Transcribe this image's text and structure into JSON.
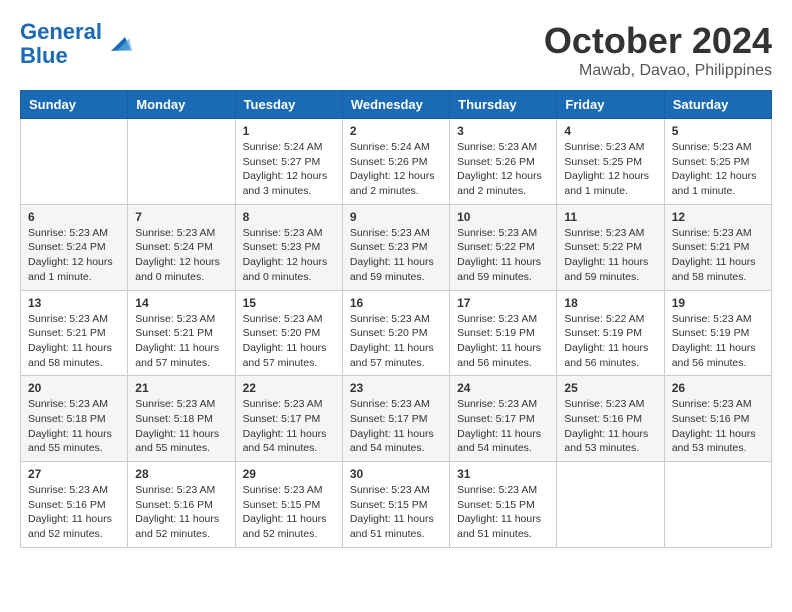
{
  "logo": {
    "line1": "General",
    "line2": "Blue"
  },
  "title": "October 2024",
  "location": "Mawab, Davao, Philippines",
  "headers": [
    "Sunday",
    "Monday",
    "Tuesday",
    "Wednesday",
    "Thursday",
    "Friday",
    "Saturday"
  ],
  "weeks": [
    [
      {
        "day": "",
        "info": ""
      },
      {
        "day": "",
        "info": ""
      },
      {
        "day": "1",
        "info": "Sunrise: 5:24 AM\nSunset: 5:27 PM\nDaylight: 12 hours and 3 minutes."
      },
      {
        "day": "2",
        "info": "Sunrise: 5:24 AM\nSunset: 5:26 PM\nDaylight: 12 hours and 2 minutes."
      },
      {
        "day": "3",
        "info": "Sunrise: 5:23 AM\nSunset: 5:26 PM\nDaylight: 12 hours and 2 minutes."
      },
      {
        "day": "4",
        "info": "Sunrise: 5:23 AM\nSunset: 5:25 PM\nDaylight: 12 hours and 1 minute."
      },
      {
        "day": "5",
        "info": "Sunrise: 5:23 AM\nSunset: 5:25 PM\nDaylight: 12 hours and 1 minute."
      }
    ],
    [
      {
        "day": "6",
        "info": "Sunrise: 5:23 AM\nSunset: 5:24 PM\nDaylight: 12 hours and 1 minute."
      },
      {
        "day": "7",
        "info": "Sunrise: 5:23 AM\nSunset: 5:24 PM\nDaylight: 12 hours and 0 minutes."
      },
      {
        "day": "8",
        "info": "Sunrise: 5:23 AM\nSunset: 5:23 PM\nDaylight: 12 hours and 0 minutes."
      },
      {
        "day": "9",
        "info": "Sunrise: 5:23 AM\nSunset: 5:23 PM\nDaylight: 11 hours and 59 minutes."
      },
      {
        "day": "10",
        "info": "Sunrise: 5:23 AM\nSunset: 5:22 PM\nDaylight: 11 hours and 59 minutes."
      },
      {
        "day": "11",
        "info": "Sunrise: 5:23 AM\nSunset: 5:22 PM\nDaylight: 11 hours and 59 minutes."
      },
      {
        "day": "12",
        "info": "Sunrise: 5:23 AM\nSunset: 5:21 PM\nDaylight: 11 hours and 58 minutes."
      }
    ],
    [
      {
        "day": "13",
        "info": "Sunrise: 5:23 AM\nSunset: 5:21 PM\nDaylight: 11 hours and 58 minutes."
      },
      {
        "day": "14",
        "info": "Sunrise: 5:23 AM\nSunset: 5:21 PM\nDaylight: 11 hours and 57 minutes."
      },
      {
        "day": "15",
        "info": "Sunrise: 5:23 AM\nSunset: 5:20 PM\nDaylight: 11 hours and 57 minutes."
      },
      {
        "day": "16",
        "info": "Sunrise: 5:23 AM\nSunset: 5:20 PM\nDaylight: 11 hours and 57 minutes."
      },
      {
        "day": "17",
        "info": "Sunrise: 5:23 AM\nSunset: 5:19 PM\nDaylight: 11 hours and 56 minutes."
      },
      {
        "day": "18",
        "info": "Sunrise: 5:22 AM\nSunset: 5:19 PM\nDaylight: 11 hours and 56 minutes."
      },
      {
        "day": "19",
        "info": "Sunrise: 5:23 AM\nSunset: 5:19 PM\nDaylight: 11 hours and 56 minutes."
      }
    ],
    [
      {
        "day": "20",
        "info": "Sunrise: 5:23 AM\nSunset: 5:18 PM\nDaylight: 11 hours and 55 minutes."
      },
      {
        "day": "21",
        "info": "Sunrise: 5:23 AM\nSunset: 5:18 PM\nDaylight: 11 hours and 55 minutes."
      },
      {
        "day": "22",
        "info": "Sunrise: 5:23 AM\nSunset: 5:17 PM\nDaylight: 11 hours and 54 minutes."
      },
      {
        "day": "23",
        "info": "Sunrise: 5:23 AM\nSunset: 5:17 PM\nDaylight: 11 hours and 54 minutes."
      },
      {
        "day": "24",
        "info": "Sunrise: 5:23 AM\nSunset: 5:17 PM\nDaylight: 11 hours and 54 minutes."
      },
      {
        "day": "25",
        "info": "Sunrise: 5:23 AM\nSunset: 5:16 PM\nDaylight: 11 hours and 53 minutes."
      },
      {
        "day": "26",
        "info": "Sunrise: 5:23 AM\nSunset: 5:16 PM\nDaylight: 11 hours and 53 minutes."
      }
    ],
    [
      {
        "day": "27",
        "info": "Sunrise: 5:23 AM\nSunset: 5:16 PM\nDaylight: 11 hours and 52 minutes."
      },
      {
        "day": "28",
        "info": "Sunrise: 5:23 AM\nSunset: 5:16 PM\nDaylight: 11 hours and 52 minutes."
      },
      {
        "day": "29",
        "info": "Sunrise: 5:23 AM\nSunset: 5:15 PM\nDaylight: 11 hours and 52 minutes."
      },
      {
        "day": "30",
        "info": "Sunrise: 5:23 AM\nSunset: 5:15 PM\nDaylight: 11 hours and 51 minutes."
      },
      {
        "day": "31",
        "info": "Sunrise: 5:23 AM\nSunset: 5:15 PM\nDaylight: 11 hours and 51 minutes."
      },
      {
        "day": "",
        "info": ""
      },
      {
        "day": "",
        "info": ""
      }
    ]
  ]
}
